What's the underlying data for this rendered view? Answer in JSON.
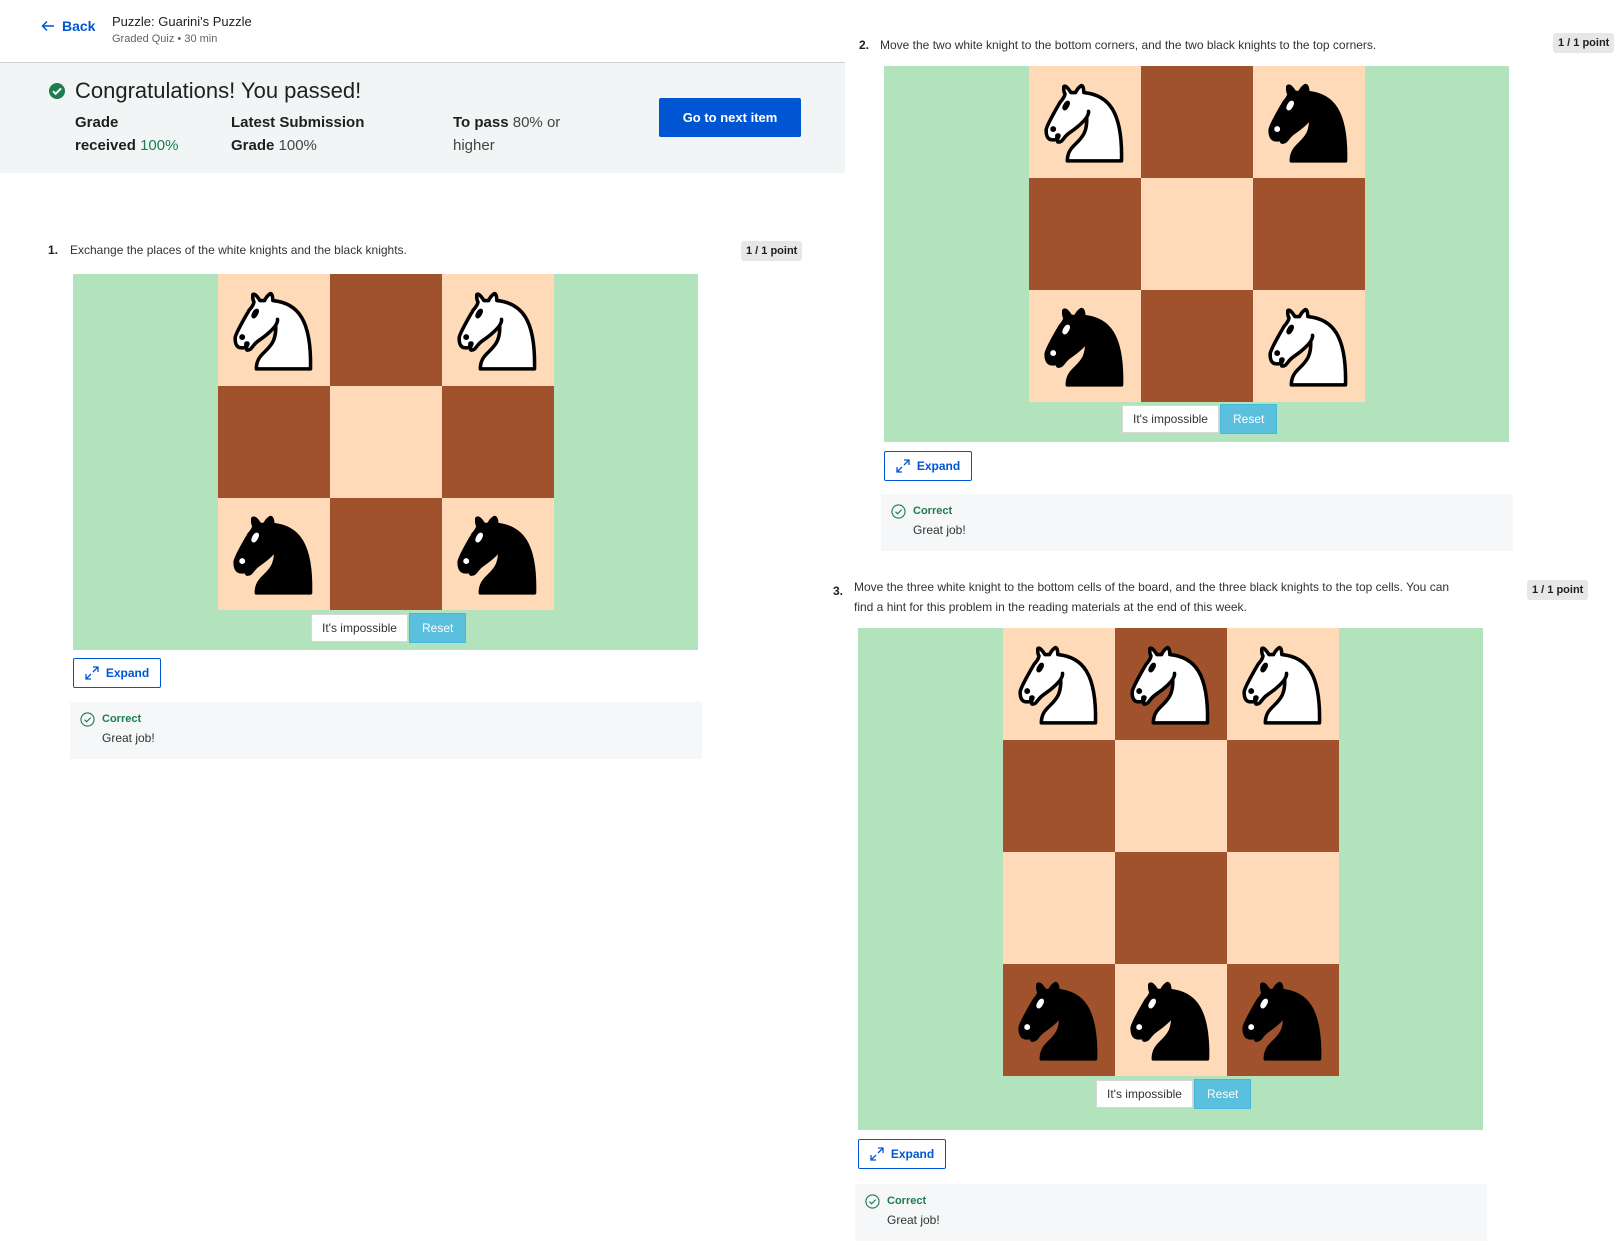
{
  "header": {
    "back_label": "Back",
    "title": "Puzzle: Guarini's Puzzle",
    "subtitle": "Graded Quiz • 30 min"
  },
  "banner": {
    "title": "Congratulations! You passed!",
    "grade_label_1": "Grade",
    "grade_label_2": "received",
    "grade_value": "100%",
    "latest_label_1": "Latest Submission",
    "latest_label_2": "Grade",
    "latest_value": "100%",
    "topass_label": "To pass",
    "topass_value_1": "80% or",
    "topass_value_2": "higher",
    "next_button": "Go to next item"
  },
  "questions": [
    {
      "number": "1.",
      "text": "Exchange the places of the white knights and the black knights.",
      "points": "1 / 1 point",
      "impossible_label": "It's impossible",
      "reset_label": "Reset",
      "expand_label": "Expand",
      "feedback_label": "Correct",
      "feedback_text": "Great job!"
    },
    {
      "number": "2.",
      "text": "Move the two white knight to the bottom corners, and the two black knights to the top corners.",
      "points": "1 / 1 point",
      "impossible_label": "It's impossible",
      "reset_label": "Reset",
      "expand_label": "Expand",
      "feedback_label": "Correct",
      "feedback_text": "Great job!"
    },
    {
      "number": "3.",
      "text_line1": "Move the three white knight to the bottom cells of the board, and the three black knights to the top cells. You can",
      "text_line2": "find a hint for this problem in the reading materials at the end of this week.",
      "points": "1 / 1 point",
      "impossible_label": "It's impossible",
      "reset_label": "Reset",
      "expand_label": "Expand",
      "feedback_label": "Correct",
      "feedback_text": "Great job!"
    }
  ],
  "colors": {
    "accent": "#0056d2",
    "success": "#1d7c50",
    "board_bg": "#b2e3bc",
    "light_square": "#fedab8",
    "dark_square": "#a0522d",
    "reset": "#5bc0de"
  },
  "icons": [
    "arrow-left-icon",
    "check-circle-icon",
    "expand-icon",
    "knight-white-icon",
    "knight-black-icon"
  ]
}
